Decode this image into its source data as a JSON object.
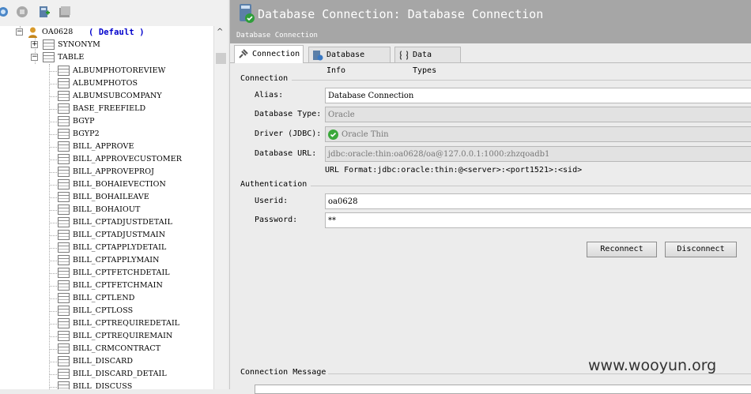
{
  "toolbar": {
    "icons": [
      "refresh-icon",
      "stop-icon",
      "new-connection-icon",
      "disconnect-all-icon"
    ]
  },
  "tree": {
    "root": {
      "label": "OA0628",
      "note": "( Default )"
    },
    "synonym": "SYNONYM",
    "table": "TABLE",
    "tables": [
      "ALBUMPHOTOREVIEW",
      "ALBUMPHOTOS",
      "ALBUMSUBCOMPANY",
      "BASE_FREEFIELD",
      "BGYP",
      "BGYP2",
      "BILL_APPROVE",
      "BILL_APPROVECUSTOMER",
      "BILL_APPROVEPROJ",
      "BILL_BOHAIEVECTION",
      "BILL_BOHAILEAVE",
      "BILL_BOHAIOUT",
      "BILL_CPTADJUSTDETAIL",
      "BILL_CPTADJUSTMAIN",
      "BILL_CPTAPPLYDETAIL",
      "BILL_CPTAPPLYMAIN",
      "BILL_CPTFETCHDETAIL",
      "BILL_CPTFETCHMAIN",
      "BILL_CPTLEND",
      "BILL_CPTLOSS",
      "BILL_CPTREQUIREDETAIL",
      "BILL_CPTREQUIREMAIN",
      "BILL_CRMCONTRACT",
      "BILL_DISCARD",
      "BILL_DISCARD_DETAIL",
      "BILL_DISCUSS"
    ]
  },
  "header": {
    "title": "Database Connection: Database Connection",
    "subtitle": "Database Connection"
  },
  "tabs": [
    "Connection",
    "Database Info",
    "Data Types"
  ],
  "connection": {
    "section": "Connection",
    "alias_label": "Alias:",
    "alias_value": "Database Connection",
    "dbtype_label": "Database Type:",
    "dbtype_value": "Oracle",
    "driver_label": "Driver (JDBC):",
    "driver_value": "Oracle Thin",
    "url_label": "Database URL:",
    "url_value": "jdbc:oracle:thin:oa0628/oa@127.0.0.1:1000:zhzqoadb1",
    "url_format": "URL Format:jdbc:oracle:thin:@<server>:<port1521>:<sid>"
  },
  "auth": {
    "section": "Authentication",
    "userid_label": "Userid:",
    "userid_value": "oa0628",
    "password_label": "Password:",
    "password_value": "**"
  },
  "buttons": {
    "reconnect": "Reconnect",
    "disconnect": "Disconnect"
  },
  "message": {
    "section": "Connection Message"
  },
  "watermark": "www.wooyun.org",
  "colors": {
    "header_bg": "#a6a6a6",
    "panel_bg": "#ececec",
    "disabled_field": "#e2e2e2",
    "driver_ok": "#3aa83a"
  }
}
